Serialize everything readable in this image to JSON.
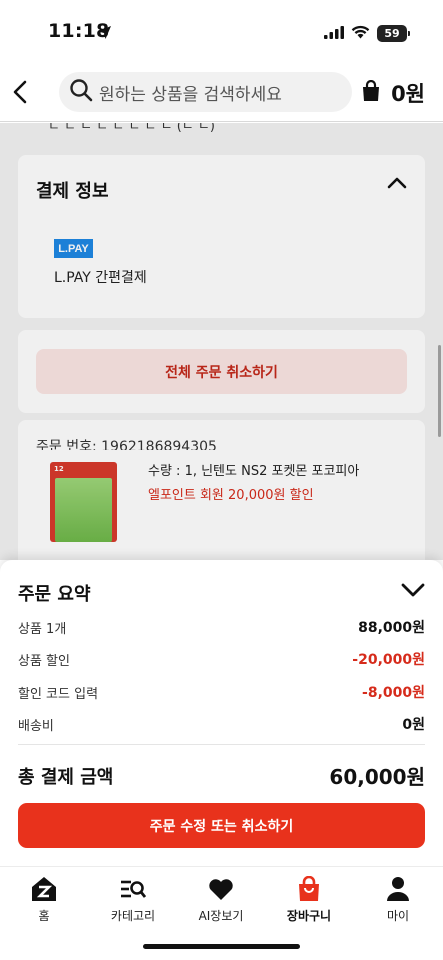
{
  "status_bar": {
    "time": "11:18",
    "battery": "59"
  },
  "header": {
    "search_placeholder": "원하는 상품을 검색하세요",
    "cart_amount": "0원"
  },
  "payment_info": {
    "partial_text": "ㄷ ㄷ ㄴ ㄷ ㄷ ㄷ ㄷ ㄴ  (ㄴ ㄴ)",
    "title": "결제 정보",
    "method_logo": "L.PAY",
    "method_label": "L.PAY 간편결제"
  },
  "cancel_all_label": "전체 주문 취소하기",
  "order_number": "주문 번호: 1962186894305",
  "product": {
    "thumb_badge": "12",
    "qty_name": "수량 : 1, 닌텐도 NS2 포켓몬 포코피아",
    "promo": "엘포인트 회원 20,000원 할인"
  },
  "summary": {
    "title": "주문 요약",
    "rows": [
      {
        "label": "상품 1개",
        "value": "88,000원"
      },
      {
        "label": "상품 할인",
        "value": "-20,000원"
      },
      {
        "label": "할인 코드 입력",
        "value": "-8,000원"
      },
      {
        "label": "배송비",
        "value": "0원"
      }
    ],
    "total_label": "총 결제 금액",
    "total_value": "60,000원",
    "button_label": "주문 수정 또는 취소하기"
  },
  "tabs": [
    {
      "label": "홈"
    },
    {
      "label": "카테고리"
    },
    {
      "label": "AI장보기"
    },
    {
      "label": "장바구니"
    },
    {
      "label": "마이"
    }
  ],
  "colors": {
    "accent": "#e8321c",
    "discount": "#d62b1b",
    "lpay": "#1e88e5"
  }
}
